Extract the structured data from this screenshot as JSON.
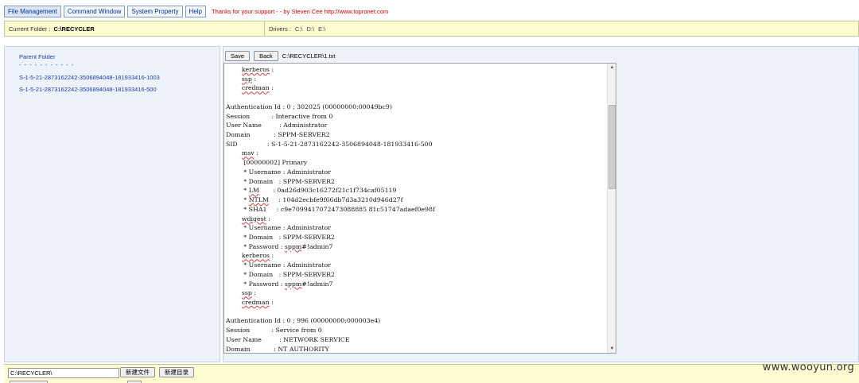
{
  "nav": {
    "tabs": [
      {
        "label": "File Management"
      },
      {
        "label": "Command Window"
      },
      {
        "label": "System Property"
      },
      {
        "label": "Help"
      }
    ],
    "thanks": "Thanks for your support - - by Steven Cee http://www.topronet.com"
  },
  "infobar": {
    "current_folder_label": "Current Folder :",
    "current_folder_value": "C:\\RECYCLER",
    "drivers_label": "Drivers :",
    "drivers": [
      "C:\\",
      "D:\\",
      "E:\\"
    ]
  },
  "sidebar": {
    "parent_label": "Parent Folder",
    "separator": "- - - - - - - - - - -",
    "items": [
      {
        "label": "S-1-5-21-2873162242-3506894048-181933416-1003"
      },
      {
        "label": "S-1-5-21-2873162242-3506894048-181933416-500"
      }
    ]
  },
  "editor": {
    "save_label": "Save",
    "back_label": "Back",
    "file_path": "C:\\RECYCLER\\1.txt",
    "lines": [
      "        kerberos :",
      "        ssp :",
      "        credman :",
      "",
      "Authentication Id : 0 ; 302025 (00000000:00049bc9)",
      "Session           : Interactive from 0",
      "User Name         : Administrator",
      "Domain            : SPPM-SERVER2",
      "SID               : S-1-5-21-2873162242-3506894048-181933416-500",
      "        msv :",
      "         [00000002] Primary",
      "         * Username : Administrator",
      "         * Domain   : SPPM-SERVER2",
      "         * LM       : 0ad26d903c16272f21c1f734caf05119",
      "         * NTLM     : 104d2ecbfe9f66db7d3a3210d946d27f",
      "         * SHA1     : c9e7099417072473088885 81c51747adaef0e98f",
      "        wdigest :",
      "         * Username : Administrator",
      "         * Domain   : SPPM-SERVER2",
      "         * Password : sppm#!admin7",
      "        kerberos :",
      "         * Username : Administrator",
      "         * Domain   : SPPM-SERVER2",
      "         * Password : sppm#!admin7",
      "        ssp :",
      "        credman :",
      "",
      "Authentication Id : 0 ; 996 (00000000:000003e4)",
      "Session           : Service from 0",
      "User Name         : NETWORK SERVICE",
      "Domain            : NT AUTHORITY"
    ]
  },
  "bottom": {
    "path_value": "C:\\RECYCLER\\",
    "new_file_label": "新建文件",
    "new_folder_label": "新建目录"
  },
  "watermark": "www.wooyun.org"
}
